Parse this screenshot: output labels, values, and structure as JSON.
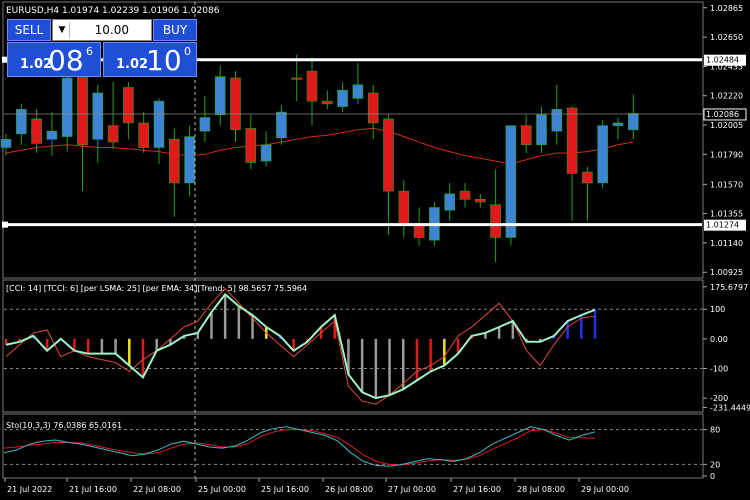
{
  "symbol_info": "EURUSD,H4  1.01974 1.02239 1.01906 1.02086",
  "trade_panel": {
    "sell_label": "SELL",
    "buy_label": "BUY",
    "lot_value": "10.00",
    "sell_price": {
      "small": "1.02",
      "big": "08",
      "sup": "6"
    },
    "buy_price": {
      "small": "1.02",
      "big": "10",
      "sup": "0"
    }
  },
  "price_axis": {
    "labels": [
      "1.02865",
      "1.02650",
      "1.02435",
      "1.02220",
      "1.02005",
      "1.01790",
      "1.01570",
      "1.01355",
      "1.01140",
      "1.00925"
    ],
    "values": [
      1.02865,
      1.0265,
      1.02435,
      1.0222,
      1.02005,
      1.0179,
      1.0157,
      1.01355,
      1.0114,
      1.00925
    ],
    "range": [
      1.0089,
      1.029
    ]
  },
  "lines": {
    "resistance": {
      "label": "1.02484",
      "value": 1.02484,
      "color": "#ffffff"
    },
    "support": {
      "label": "1.01274",
      "value": 1.01274,
      "color": "#ffffff"
    },
    "current": {
      "label": "1.02086",
      "value": 1.02086
    }
  },
  "candles": [
    [
      1.0184,
      1.0194,
      1.0178,
      1.019
    ],
    [
      1.0194,
      1.0216,
      1.0186,
      1.0212
    ],
    [
      1.0205,
      1.0212,
      1.018,
      1.0187
    ],
    [
      1.019,
      1.021,
      1.0178,
      1.0196
    ],
    [
      1.0192,
      1.0242,
      1.0181,
      1.0235
    ],
    [
      1.024,
      1.0252,
      1.0152,
      1.0186
    ],
    [
      1.019,
      1.023,
      1.0173,
      1.0224
    ],
    [
      1.02,
      1.0232,
      1.0183,
      1.0188
    ],
    [
      1.0228,
      1.0232,
      1.019,
      1.0202
    ],
    [
      1.0202,
      1.021,
      1.018,
      1.0184
    ],
    [
      1.0184,
      1.022,
      1.0172,
      1.0218
    ],
    [
      1.019,
      1.0198,
      1.0133,
      1.0158
    ],
    [
      1.0158,
      1.02,
      1.0148,
      1.0192
    ],
    [
      1.0196,
      1.0222,
      1.0188,
      1.0206
    ],
    [
      1.0208,
      1.0244,
      1.02,
      1.0236
    ],
    [
      1.0235,
      1.024,
      1.0188,
      1.0197
    ],
    [
      1.0198,
      1.0208,
      1.0168,
      1.0173
    ],
    [
      1.0174,
      1.0196,
      1.017,
      1.0186
    ],
    [
      1.0191,
      1.0215,
      1.0186,
      1.021
    ],
    [
      1.0235,
      1.0252,
      1.0218,
      1.0234
    ],
    [
      1.024,
      1.025,
      1.02,
      1.0218
    ],
    [
      1.0218,
      1.0226,
      1.0212,
      1.0216
    ],
    [
      1.0214,
      1.0232,
      1.021,
      1.0226
    ],
    [
      1.022,
      1.0246,
      1.0216,
      1.023
    ],
    [
      1.0224,
      1.023,
      1.019,
      1.0202
    ],
    [
      1.0205,
      1.0208,
      1.012,
      1.0152
    ],
    [
      1.0152,
      1.016,
      1.0118,
      1.0128
    ],
    [
      1.0128,
      1.014,
      1.0112,
      1.0118
    ],
    [
      1.0116,
      1.0144,
      1.0112,
      1.014
    ],
    [
      1.0138,
      1.0158,
      1.013,
      1.015
    ],
    [
      1.0152,
      1.0158,
      1.014,
      1.0146
    ],
    [
      1.0146,
      1.015,
      1.014,
      1.0144
    ],
    [
      1.0142,
      1.0168,
      1.01,
      1.0118
    ],
    [
      1.0118,
      1.0178,
      1.0112,
      1.02
    ],
    [
      1.02,
      1.0208,
      1.018,
      1.0186
    ],
    [
      1.0186,
      1.0214,
      1.018,
      1.0208
    ],
    [
      1.0196,
      1.023,
      1.0186,
      1.0212
    ],
    [
      1.0213,
      1.0214,
      1.013,
      1.0165
    ],
    [
      1.0166,
      1.017,
      1.013,
      1.0158
    ],
    [
      1.0158,
      1.0204,
      1.0154,
      1.02
    ],
    [
      1.02,
      1.0206,
      1.019,
      1.0202
    ],
    [
      1.0197,
      1.0223,
      1.019,
      1.0209
    ]
  ],
  "ma_line": [
    1.018,
    1.0182,
    1.0184,
    1.0185,
    1.0186,
    1.0185,
    1.0184,
    1.0184,
    1.0183,
    1.0182,
    1.0181,
    1.0179,
    1.0178,
    1.0179,
    1.0182,
    1.0184,
    1.0185,
    1.0186,
    1.0188,
    1.019,
    1.0192,
    1.0193,
    1.0195,
    1.0197,
    1.0198,
    1.0196,
    1.0192,
    1.0188,
    1.0184,
    1.0181,
    1.0178,
    1.0176,
    1.0174,
    1.0172,
    1.0175,
    1.0178,
    1.018,
    1.018,
    1.0181,
    1.0183,
    1.0186,
    1.0188
  ],
  "cci_panel": {
    "label": "[CCI: 14] [TCCI: 6] [per LSMA: 25] [per EMA: 34][Trend: 5]  98.5657 75.5964",
    "axis_labels": [
      "175.6797",
      "100",
      "0.00",
      "-100",
      "-200",
      "-231.4449"
    ],
    "axis_values": [
      175.68,
      100,
      0,
      -100,
      -200,
      -231.44
    ],
    "range": [
      -240,
      185
    ],
    "cci": [
      -20,
      -10,
      10,
      -40,
      0,
      -40,
      -50,
      -50,
      -50,
      -90,
      -130,
      -40,
      -20,
      10,
      20,
      90,
      150,
      110,
      80,
      40,
      10,
      -40,
      -10,
      40,
      80,
      -120,
      -180,
      -200,
      -190,
      -170,
      -140,
      -110,
      -90,
      -50,
      10,
      20,
      40,
      60,
      -10,
      -10,
      10,
      60,
      80,
      98
    ],
    "tcci": [
      -60,
      -20,
      20,
      30,
      -60,
      -40,
      -60,
      -70,
      -80,
      -110,
      -70,
      -40,
      0,
      40,
      60,
      120,
      170,
      120,
      70,
      20,
      -20,
      -60,
      -20,
      20,
      60,
      -160,
      -210,
      -220,
      -190,
      -150,
      -110,
      -90,
      -60,
      10,
      40,
      80,
      120,
      60,
      -40,
      -90,
      -20,
      40,
      70,
      76
    ],
    "hist_colors": [
      "red",
      "red",
      "blue",
      "red",
      "red",
      "red",
      "red",
      "gray",
      "gray",
      "yellow",
      "red",
      "gray",
      "gray",
      "gray",
      "gray",
      "gray",
      "gray",
      "gray",
      "gray",
      "yellow",
      "blue",
      "red",
      "red",
      "red",
      "red",
      "gray",
      "gray",
      "gray",
      "gray",
      "gray",
      "red",
      "red",
      "yellow",
      "red",
      "red",
      "gray",
      "gray",
      "gray",
      "gray",
      "gray",
      "blue",
      "blue",
      "blue",
      "blue"
    ]
  },
  "sto_panel": {
    "label": "Sto(10,3,3) 76.0386 65.0161",
    "axis_labels": [
      "80",
      "20",
      "0"
    ],
    "axis_values": [
      80,
      20,
      0
    ],
    "k": [
      40,
      45,
      55,
      60,
      62,
      58,
      55,
      50,
      45,
      40,
      35,
      38,
      45,
      55,
      60,
      55,
      50,
      48,
      52,
      62,
      75,
      82,
      85,
      80,
      75,
      70,
      60,
      40,
      25,
      18,
      17,
      20,
      25,
      30,
      28,
      25,
      30,
      40,
      55,
      65,
      75,
      85,
      80,
      70,
      62,
      70,
      76
    ],
    "d": [
      48,
      50,
      53,
      55,
      58,
      58,
      57,
      53,
      48,
      44,
      40,
      38,
      40,
      48,
      55,
      57,
      54,
      50,
      50,
      56,
      68,
      76,
      80,
      80,
      78,
      73,
      66,
      52,
      36,
      25,
      20,
      19,
      22,
      26,
      28,
      27,
      29,
      35,
      46,
      56,
      66,
      78,
      80,
      74,
      66,
      66,
      65
    ]
  },
  "time_axis": [
    "21 Jul 2022",
    "21 Jul 16:00",
    "22 Jul 08:00",
    "25 Jul 00:00",
    "25 Jul 16:00",
    "26 Jul 08:00",
    "27 Jul 00:00",
    "27 Jul 16:00",
    "28 Jul 08:00",
    "29 Jul 00:00"
  ],
  "colors": {
    "bull": "#3e84d4",
    "bear": "#e01a1a",
    "wick": "#21a11f",
    "ma": "#d62a12",
    "grid": "#555555",
    "cci_line": "#9ff3c8",
    "tcci_line": "#e04a3a",
    "sto_k": "#3fb7c6",
    "sto_d": "#d21f1f"
  }
}
